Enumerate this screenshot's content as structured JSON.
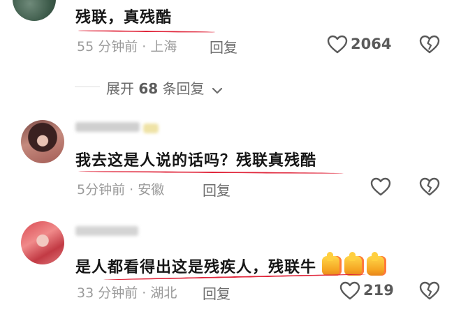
{
  "comments": [
    {
      "text": "残联，真残酷",
      "time_location": "55 分钟前 · 上海",
      "reply_label": "回复",
      "like_count": "2064",
      "replies": {
        "prefix": "展开",
        "count": "68",
        "suffix": "条回复"
      }
    },
    {
      "text": "我去这是人说的话吗？残联真残酷",
      "time_location": "5分钟前 · 安徽",
      "reply_label": "回复"
    },
    {
      "text": "是人都看得出这是残疾人，残联牛",
      "emoji": [
        "thumbs-up",
        "thumbs-up",
        "thumbs-up"
      ],
      "time_location": "33 分钟前 · 湖北",
      "reply_label": "回复",
      "like_count": "219"
    }
  ],
  "colors": {
    "underline": "#e0253a",
    "meta_text": "#9a9a9a",
    "comment_text": "#161616"
  },
  "icons": {
    "like": "heart-outline-icon",
    "dislike": "broken-heart-icon",
    "expand": "chevron-down-icon"
  }
}
